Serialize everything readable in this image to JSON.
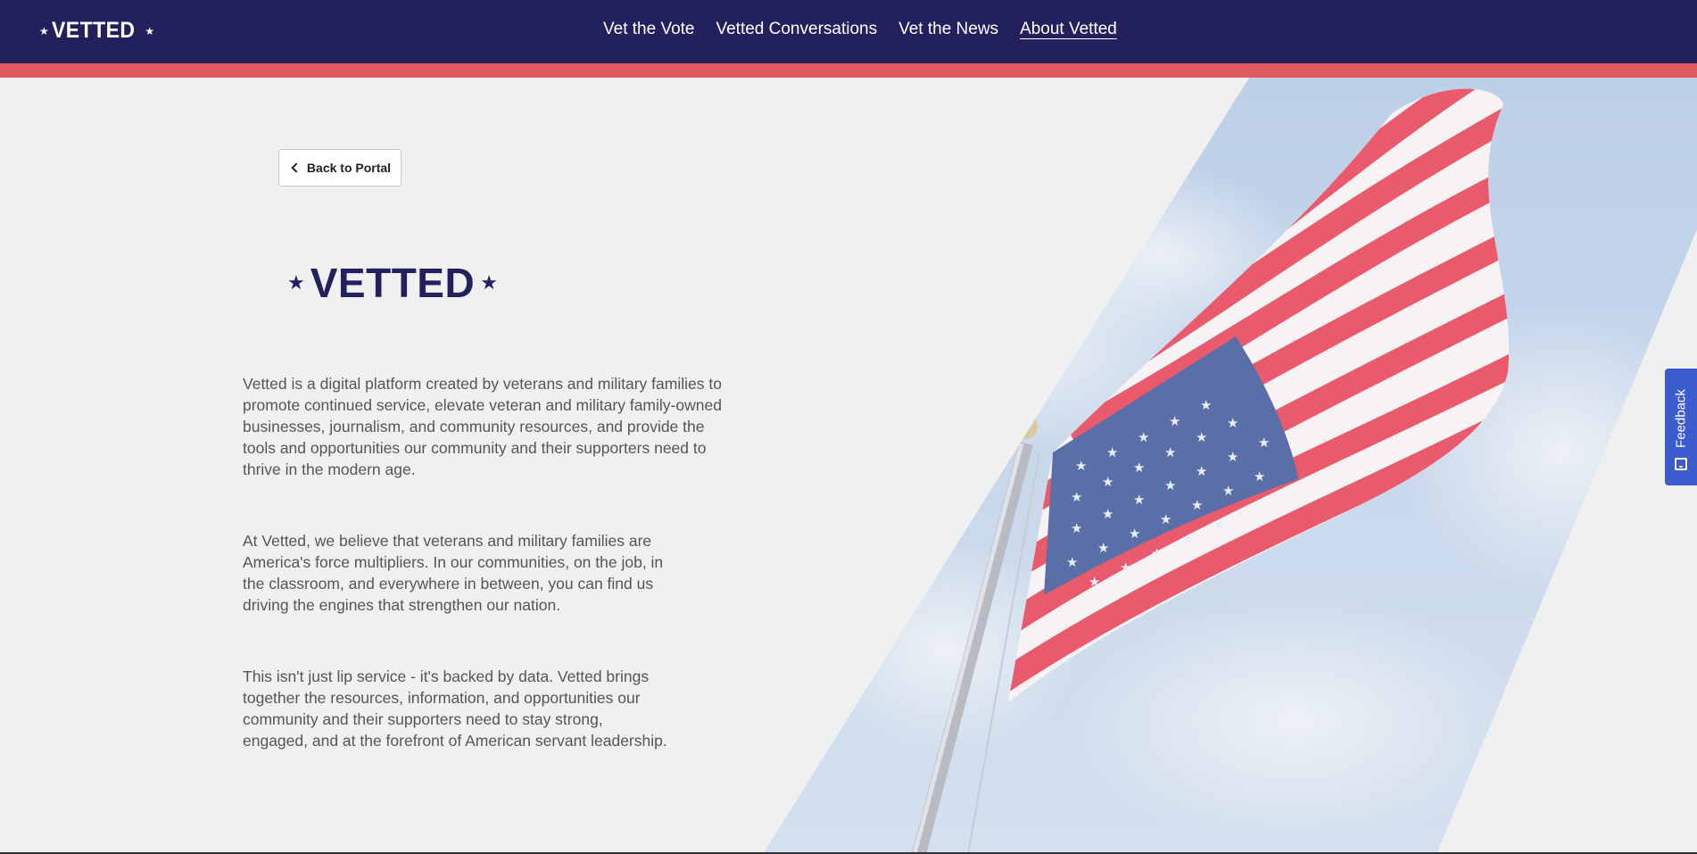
{
  "header": {
    "logo_text": "VETTED",
    "nav": [
      {
        "label": "Vet the Vote"
      },
      {
        "label": "Vetted Conversations"
      },
      {
        "label": "Vet the News"
      },
      {
        "label": "About Vetted"
      }
    ],
    "active_nav": "About Vetted"
  },
  "main": {
    "back_button": "Back to Portal",
    "logo_text": "VETTED",
    "paragraphs": [
      "Vetted is a digital platform created by veterans and military families to promote continued service, elevate veteran and military family-owned businesses, journalism, and community resources, and provide the tools and opportunities our community and their supporters need to thrive in the modern age.",
      "At Vetted, we believe that veterans and military families are America's force multipliers. In our communities, on the job, in the classroom, and everywhere in between, you can find us driving the engines that strengthen our nation.",
      "This isn't just lip service - it's backed by data. Vetted brings together the resources, information, and opportunities our community and their supporters need to stay strong, engaged, and at the forefront of American servant leadership."
    ]
  },
  "feedback": {
    "label": "Feedback"
  },
  "colors": {
    "navy": "#22215d",
    "stripe_red": "#e05a5e",
    "background": "#f0f0f0",
    "feedback_blue": "#3b5ccc"
  },
  "icons": [
    "star-icon",
    "chevron-left-icon",
    "feedback-icon"
  ]
}
